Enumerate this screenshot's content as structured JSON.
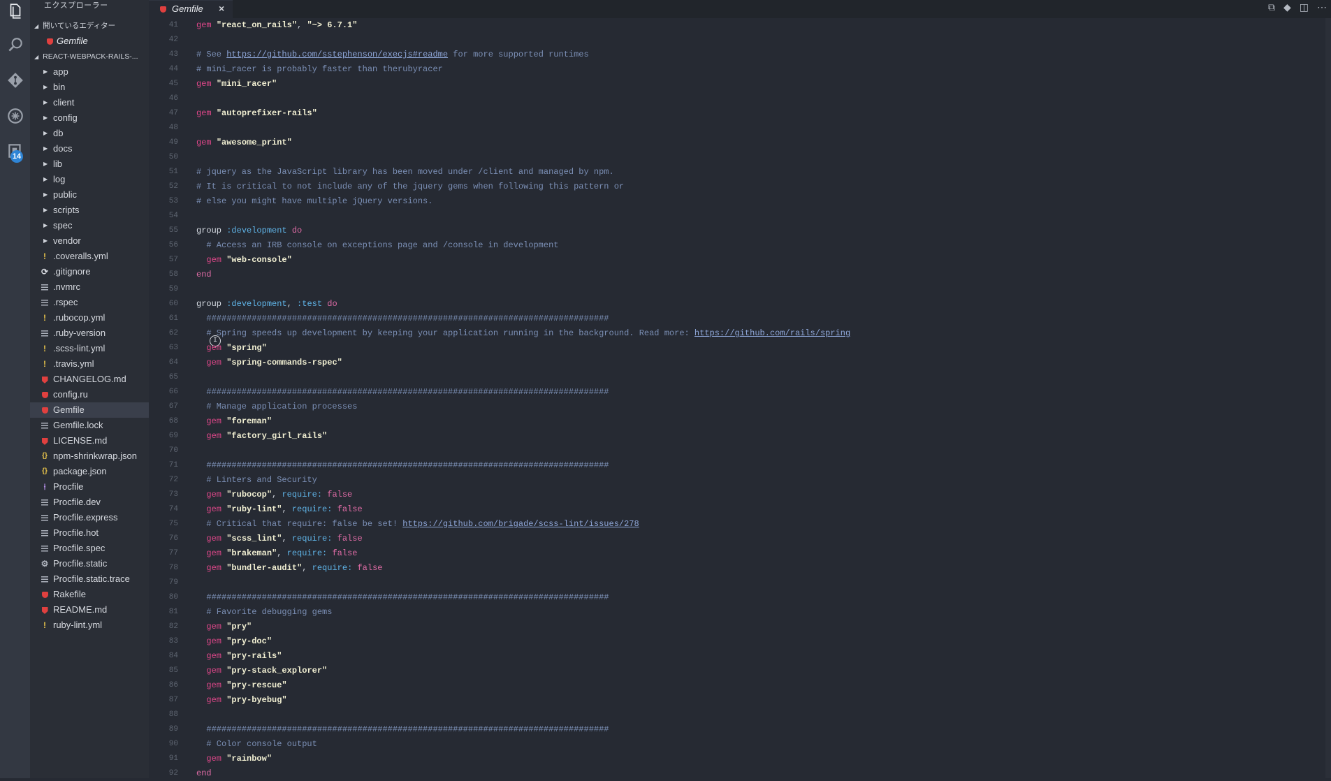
{
  "activity": {
    "badge_count": "14"
  },
  "sidebar": {
    "title": "エクスプローラー",
    "open_editors_label": "開いているエディター",
    "open_editor_file": "Gemfile",
    "project_label": "REACT-WEBPACK-RAILS-...",
    "items": [
      {
        "label": "app",
        "type": "folder"
      },
      {
        "label": "bin",
        "type": "folder"
      },
      {
        "label": "client",
        "type": "folder"
      },
      {
        "label": "config",
        "type": "folder"
      },
      {
        "label": "db",
        "type": "folder"
      },
      {
        "label": "docs",
        "type": "folder"
      },
      {
        "label": "lib",
        "type": "folder"
      },
      {
        "label": "log",
        "type": "folder"
      },
      {
        "label": "public",
        "type": "folder"
      },
      {
        "label": "scripts",
        "type": "folder"
      },
      {
        "label": "spec",
        "type": "folder"
      },
      {
        "label": "vendor",
        "type": "folder"
      },
      {
        "label": ".coveralls.yml",
        "type": "yml"
      },
      {
        "label": ".gitignore",
        "type": "git"
      },
      {
        "label": ".nvmrc",
        "type": "text"
      },
      {
        "label": ".rspec",
        "type": "text"
      },
      {
        "label": ".rubocop.yml",
        "type": "yml"
      },
      {
        "label": ".ruby-version",
        "type": "text"
      },
      {
        "label": ".scss-lint.yml",
        "type": "yml"
      },
      {
        "label": ".travis.yml",
        "type": "yml"
      },
      {
        "label": "CHANGELOG.md",
        "type": "md"
      },
      {
        "label": "config.ru",
        "type": "ruby"
      },
      {
        "label": "Gemfile",
        "type": "ruby",
        "selected": true
      },
      {
        "label": "Gemfile.lock",
        "type": "text"
      },
      {
        "label": "LICENSE.md",
        "type": "md"
      },
      {
        "label": "npm-shrinkwrap.json",
        "type": "json"
      },
      {
        "label": "package.json",
        "type": "json"
      },
      {
        "label": "Procfile",
        "type": "proc"
      },
      {
        "label": "Procfile.dev",
        "type": "text"
      },
      {
        "label": "Procfile.express",
        "type": "text"
      },
      {
        "label": "Procfile.hot",
        "type": "text"
      },
      {
        "label": "Procfile.spec",
        "type": "text"
      },
      {
        "label": "Procfile.static",
        "type": "gear"
      },
      {
        "label": "Procfile.static.trace",
        "type": "text"
      },
      {
        "label": "Rakefile",
        "type": "ruby"
      },
      {
        "label": "README.md",
        "type": "md"
      },
      {
        "label": "ruby-lint.yml",
        "type": "yml"
      }
    ]
  },
  "tab": {
    "label": "Gemfile",
    "close": "×"
  },
  "editor": {
    "lines": [
      {
        "n": "41",
        "segs": [
          [
            "gem",
            "gem"
          ],
          [
            "t",
            " "
          ],
          [
            "str",
            "\"react_on_rails\""
          ],
          [
            "t",
            ", "
          ],
          [
            "str",
            "\"~> 6.7.1\""
          ]
        ]
      },
      {
        "n": "42",
        "segs": []
      },
      {
        "n": "43",
        "segs": [
          [
            "cm",
            "# See "
          ],
          [
            "link",
            "https://github.com/sstephenson/execjs#readme"
          ],
          [
            "cm",
            " for more supported runtimes"
          ]
        ]
      },
      {
        "n": "44",
        "segs": [
          [
            "cm",
            "# mini_racer is probably faster than therubyracer"
          ]
        ]
      },
      {
        "n": "45",
        "segs": [
          [
            "gem",
            "gem"
          ],
          [
            "t",
            " "
          ],
          [
            "str",
            "\"mini_racer\""
          ]
        ]
      },
      {
        "n": "46",
        "segs": []
      },
      {
        "n": "47",
        "segs": [
          [
            "gem",
            "gem"
          ],
          [
            "t",
            " "
          ],
          [
            "str",
            "\"autoprefixer-rails\""
          ]
        ]
      },
      {
        "n": "48",
        "segs": []
      },
      {
        "n": "49",
        "segs": [
          [
            "gem",
            "gem"
          ],
          [
            "t",
            " "
          ],
          [
            "str",
            "\"awesome_print\""
          ]
        ]
      },
      {
        "n": "50",
        "segs": []
      },
      {
        "n": "51",
        "segs": [
          [
            "cm",
            "# jquery as the JavaScript library has been moved under /client and managed by npm."
          ]
        ]
      },
      {
        "n": "52",
        "segs": [
          [
            "cm",
            "# It is critical to not include any of the jquery gems when following this pattern or"
          ]
        ]
      },
      {
        "n": "53",
        "segs": [
          [
            "cm",
            "# else you might have multiple jQuery versions."
          ]
        ]
      },
      {
        "n": "54",
        "segs": []
      },
      {
        "n": "55",
        "segs": [
          [
            "grp",
            "group"
          ],
          [
            "t",
            " "
          ],
          [
            "sym",
            ":development"
          ],
          [
            "t",
            " "
          ],
          [
            "kw2",
            "do"
          ]
        ]
      },
      {
        "n": "56",
        "segs": [
          [
            "cm",
            "  # Access an IRB console on exceptions page and /console in development"
          ]
        ]
      },
      {
        "n": "57",
        "segs": [
          [
            "t",
            "  "
          ],
          [
            "gem",
            "gem"
          ],
          [
            "t",
            " "
          ],
          [
            "str",
            "\"web-console\""
          ]
        ]
      },
      {
        "n": "58",
        "segs": [
          [
            "kw2",
            "end"
          ]
        ]
      },
      {
        "n": "59",
        "segs": []
      },
      {
        "n": "60",
        "segs": [
          [
            "grp",
            "group"
          ],
          [
            "t",
            " "
          ],
          [
            "sym",
            ":development"
          ],
          [
            "t",
            ", "
          ],
          [
            "sym",
            ":test"
          ],
          [
            "t",
            " "
          ],
          [
            "kw2",
            "do"
          ]
        ]
      },
      {
        "n": "61",
        "segs": [
          [
            "cm",
            "  ################################################################################"
          ]
        ]
      },
      {
        "n": "62",
        "segs": [
          [
            "cm",
            "  # Spring speeds up development by keeping your application running in the background. Read more: "
          ],
          [
            "link",
            "https://github.com/rails/spring"
          ]
        ]
      },
      {
        "n": "63",
        "segs": [
          [
            "t",
            "  "
          ],
          [
            "gem",
            "gem"
          ],
          [
            "t",
            " "
          ],
          [
            "str",
            "\"spring\""
          ]
        ]
      },
      {
        "n": "64",
        "segs": [
          [
            "t",
            "  "
          ],
          [
            "gem",
            "gem"
          ],
          [
            "t",
            " "
          ],
          [
            "str",
            "\"spring-commands-rspec\""
          ]
        ]
      },
      {
        "n": "65",
        "segs": []
      },
      {
        "n": "66",
        "segs": [
          [
            "cm",
            "  ################################################################################"
          ]
        ]
      },
      {
        "n": "67",
        "segs": [
          [
            "cm",
            "  # Manage application processes"
          ]
        ]
      },
      {
        "n": "68",
        "segs": [
          [
            "t",
            "  "
          ],
          [
            "gem",
            "gem"
          ],
          [
            "t",
            " "
          ],
          [
            "str",
            "\"foreman\""
          ]
        ]
      },
      {
        "n": "69",
        "segs": [
          [
            "t",
            "  "
          ],
          [
            "gem",
            "gem"
          ],
          [
            "t",
            " "
          ],
          [
            "str",
            "\"factory_girl_rails\""
          ]
        ]
      },
      {
        "n": "70",
        "segs": []
      },
      {
        "n": "71",
        "segs": [
          [
            "cm",
            "  ################################################################################"
          ]
        ]
      },
      {
        "n": "72",
        "segs": [
          [
            "cm",
            "  # Linters and Security"
          ]
        ]
      },
      {
        "n": "73",
        "segs": [
          [
            "t",
            "  "
          ],
          [
            "gem",
            "gem"
          ],
          [
            "t",
            " "
          ],
          [
            "str",
            "\"rubocop\""
          ],
          [
            "t",
            ", "
          ],
          [
            "sym",
            "require:"
          ],
          [
            "t",
            " "
          ],
          [
            "kw2",
            "false"
          ]
        ]
      },
      {
        "n": "74",
        "segs": [
          [
            "t",
            "  "
          ],
          [
            "gem",
            "gem"
          ],
          [
            "t",
            " "
          ],
          [
            "str",
            "\"ruby-lint\""
          ],
          [
            "t",
            ", "
          ],
          [
            "sym",
            "require:"
          ],
          [
            "t",
            " "
          ],
          [
            "kw2",
            "false"
          ]
        ]
      },
      {
        "n": "75",
        "segs": [
          [
            "cm",
            "  # Critical that require: false be set! "
          ],
          [
            "link",
            "https://github.com/brigade/scss-lint/issues/278"
          ]
        ]
      },
      {
        "n": "76",
        "segs": [
          [
            "t",
            "  "
          ],
          [
            "gem",
            "gem"
          ],
          [
            "t",
            " "
          ],
          [
            "str",
            "\"scss_lint\""
          ],
          [
            "t",
            ", "
          ],
          [
            "sym",
            "require:"
          ],
          [
            "t",
            " "
          ],
          [
            "kw2",
            "false"
          ]
        ]
      },
      {
        "n": "77",
        "segs": [
          [
            "t",
            "  "
          ],
          [
            "gem",
            "gem"
          ],
          [
            "t",
            " "
          ],
          [
            "str",
            "\"brakeman\""
          ],
          [
            "t",
            ", "
          ],
          [
            "sym",
            "require:"
          ],
          [
            "t",
            " "
          ],
          [
            "kw2",
            "false"
          ]
        ]
      },
      {
        "n": "78",
        "segs": [
          [
            "t",
            "  "
          ],
          [
            "gem",
            "gem"
          ],
          [
            "t",
            " "
          ],
          [
            "str",
            "\"bundler-audit\""
          ],
          [
            "t",
            ", "
          ],
          [
            "sym",
            "require:"
          ],
          [
            "t",
            " "
          ],
          [
            "kw2",
            "false"
          ]
        ]
      },
      {
        "n": "79",
        "segs": []
      },
      {
        "n": "80",
        "segs": [
          [
            "cm",
            "  ################################################################################"
          ]
        ]
      },
      {
        "n": "81",
        "segs": [
          [
            "cm",
            "  # Favorite debugging gems"
          ]
        ]
      },
      {
        "n": "82",
        "segs": [
          [
            "t",
            "  "
          ],
          [
            "gem",
            "gem"
          ],
          [
            "t",
            " "
          ],
          [
            "str",
            "\"pry\""
          ]
        ]
      },
      {
        "n": "83",
        "segs": [
          [
            "t",
            "  "
          ],
          [
            "gem",
            "gem"
          ],
          [
            "t",
            " "
          ],
          [
            "str",
            "\"pry-doc\""
          ]
        ]
      },
      {
        "n": "84",
        "segs": [
          [
            "t",
            "  "
          ],
          [
            "gem",
            "gem"
          ],
          [
            "t",
            " "
          ],
          [
            "str",
            "\"pry-rails\""
          ]
        ]
      },
      {
        "n": "85",
        "segs": [
          [
            "t",
            "  "
          ],
          [
            "gem",
            "gem"
          ],
          [
            "t",
            " "
          ],
          [
            "str",
            "\"pry-stack_explorer\""
          ]
        ]
      },
      {
        "n": "86",
        "segs": [
          [
            "t",
            "  "
          ],
          [
            "gem",
            "gem"
          ],
          [
            "t",
            " "
          ],
          [
            "str",
            "\"pry-rescue\""
          ]
        ]
      },
      {
        "n": "87",
        "segs": [
          [
            "t",
            "  "
          ],
          [
            "gem",
            "gem"
          ],
          [
            "t",
            " "
          ],
          [
            "str",
            "\"pry-byebug\""
          ]
        ]
      },
      {
        "n": "88",
        "segs": []
      },
      {
        "n": "89",
        "segs": [
          [
            "cm",
            "  ################################################################################"
          ]
        ]
      },
      {
        "n": "90",
        "segs": [
          [
            "cm",
            "  # Color console output"
          ]
        ]
      },
      {
        "n": "91",
        "segs": [
          [
            "t",
            "  "
          ],
          [
            "gem",
            "gem"
          ],
          [
            "t",
            " "
          ],
          [
            "str",
            "\"rainbow\""
          ]
        ]
      },
      {
        "n": "92",
        "segs": [
          [
            "kw2",
            "end"
          ]
        ]
      }
    ]
  }
}
